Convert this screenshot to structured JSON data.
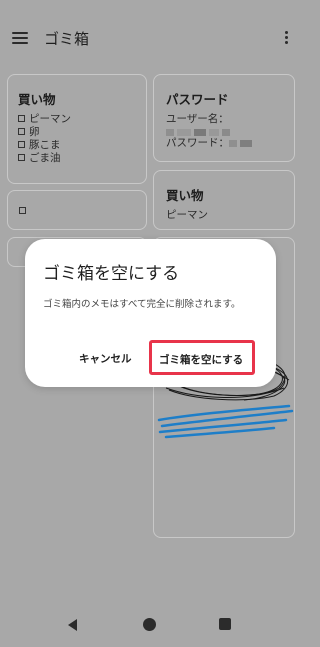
{
  "app_bar": {
    "title": "ゴミ箱"
  },
  "notes": [
    {
      "title": "買い物",
      "items": [
        "ピーマン",
        "卵",
        "豚こま",
        "ごま油"
      ]
    },
    {
      "title": "パスワード",
      "lines": [
        "ユーザー名：",
        "パスワード："
      ]
    },
    {
      "title": "買い物",
      "body": "ピーマン"
    }
  ],
  "dialog": {
    "title": "ゴミ箱を空にする",
    "message": "ゴミ箱内のメモはすべて完全に削除されます。",
    "cancel_label": "キャンセル",
    "confirm_label": "ゴミ箱を空にする",
    "highlight_color": "#e8344a"
  },
  "system_nav": {
    "back": "back-icon",
    "home": "home-icon",
    "recents": "recents-icon"
  }
}
